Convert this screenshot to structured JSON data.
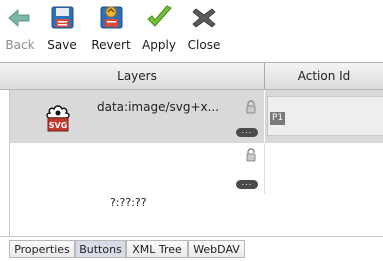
{
  "toolbar": {
    "buttons": [
      {
        "label": "Back",
        "icon": "back-arrow-icon",
        "enabled": false
      },
      {
        "label": "Save",
        "icon": "floppy-disk-icon",
        "enabled": true
      },
      {
        "label": "Revert",
        "icon": "revert-icon",
        "enabled": true
      },
      {
        "label": "Apply",
        "icon": "checkmark-icon",
        "enabled": true
      },
      {
        "label": "Close",
        "icon": "close-x-icon",
        "enabled": true
      }
    ]
  },
  "table": {
    "columns": [
      "Layers",
      "Action Id"
    ],
    "rows": [
      {
        "name": "data:image/svg+x...",
        "thumbnail_icon": "svg-file-icon",
        "lock_icon": "lock-icon",
        "more_label": "...",
        "action_id": "P1",
        "selected": true
      },
      {
        "name": "",
        "lock_icon": "lock-icon",
        "more_label": "...",
        "time": "?:??:??",
        "action_id": "",
        "selected": false
      }
    ]
  },
  "tabs": [
    "Properties",
    "Buttons",
    "XML Tree",
    "WebDAV"
  ],
  "active_tab": "Buttons",
  "colors": {
    "selected_row": "#d9d9d9",
    "apply_green": "#6dbf2f",
    "back_green": "#6aab96",
    "close_gray": "#5a5a5a"
  }
}
